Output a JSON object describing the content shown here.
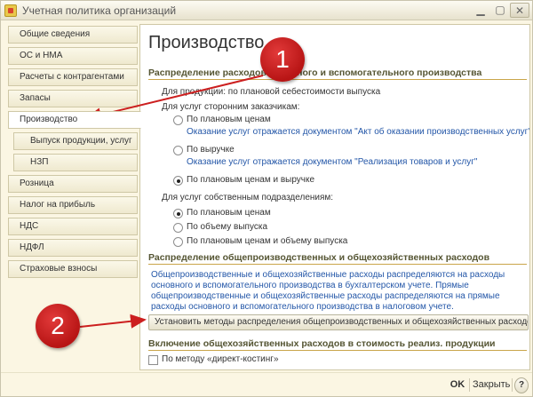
{
  "window": {
    "title": "Учетная политика организаций"
  },
  "sidebar": {
    "items": [
      {
        "label": "Общие сведения"
      },
      {
        "label": "ОС и НМА"
      },
      {
        "label": "Расчеты с контрагентами"
      },
      {
        "label": "Запасы"
      },
      {
        "label": "Производство"
      },
      {
        "label": "Выпуск продукции, услуг"
      },
      {
        "label": "НЗП"
      },
      {
        "label": "Розница"
      },
      {
        "label": "Налог на прибыль"
      },
      {
        "label": "НДС"
      },
      {
        "label": "НДФЛ"
      },
      {
        "label": "Страховые взносы"
      }
    ]
  },
  "content": {
    "title": "Производство",
    "section1": {
      "heading": "Распределение расходов основного и вспомогательного производства",
      "products_text": "Для продукции: по плановой себестоимости выпуска",
      "third_party_label": "Для услуг сторонним заказчикам:",
      "third_party_options": [
        {
          "label": "По плановым ценам",
          "hint": "Оказание услуг отражается документом \"Акт об оказании производственных услуг\""
        },
        {
          "label": "По выручке",
          "hint": "Оказание услуг отражается документом \"Реализация товаров и услуг\""
        },
        {
          "label": "По плановым ценам и выручке"
        }
      ],
      "own_divisions_label": "Для услуг собственным подразделениям:",
      "own_options": [
        {
          "label": "По плановым ценам"
        },
        {
          "label": "По объему выпуска"
        },
        {
          "label": "По плановым ценам и объему выпуска"
        }
      ]
    },
    "section2": {
      "heading": "Распределение общепроизводственных и общехозяйственных расходов",
      "description": "Общепроизводственные и общехозяйственные расходы распределяются на расходы основного и вспомогательного производства в бухгалтерском учете. Прямые общепроизводственные и общехозяйственные расходы распределяются на прямые расходы основного и вспомогательного производства в налоговом учете.",
      "button_label": "Установить методы распределения общепроизводственных и общехозяйственных расходов ..."
    },
    "section3": {
      "heading": "Включение общехозяйственных расходов в стоимость реализ. продукции",
      "checkbox_label": "По методу «директ-костинг»"
    }
  },
  "footer": {
    "ok_label": "OK",
    "close_label": "Закрыть",
    "help_label": "?"
  },
  "annotations": {
    "marker1": "1",
    "marker2": "2"
  },
  "colors": {
    "accent_red": "#cc1f1f",
    "hint_blue": "#2457a8",
    "section_line": "#c9a54a"
  }
}
